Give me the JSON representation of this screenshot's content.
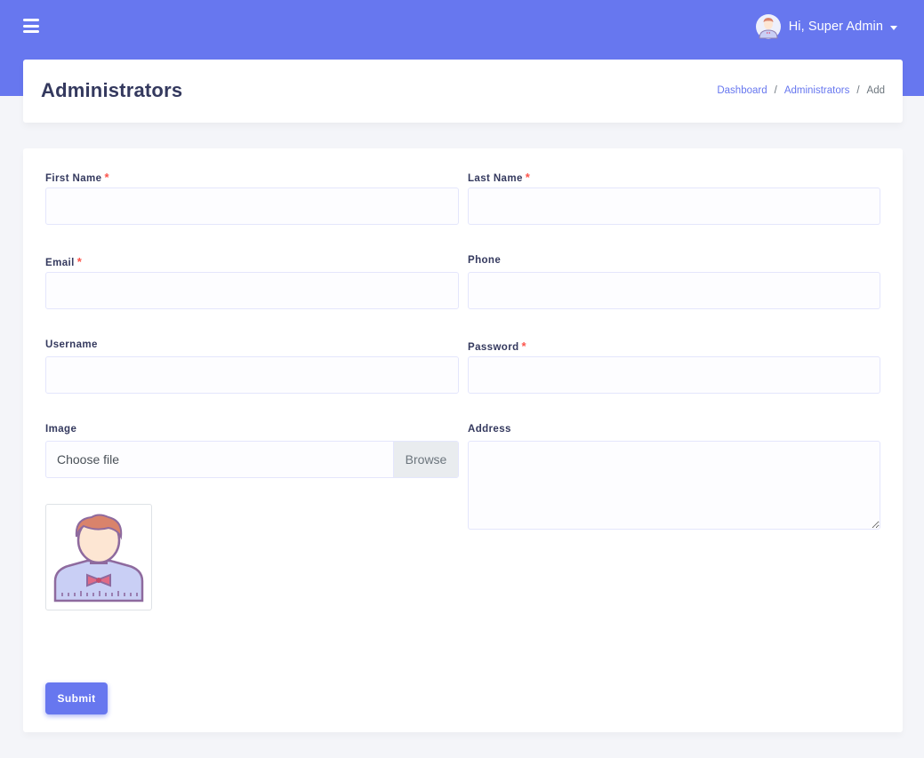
{
  "topbar": {
    "menu_icon": "hamburger-icon",
    "user_greeting": "Hi, Super Admin",
    "avatar_icon": "user-avatar-icon"
  },
  "header": {
    "title": "Administrators",
    "breadcrumb": [
      "Dashboard",
      "Administrators",
      "Add"
    ],
    "separator": "/"
  },
  "form": {
    "first_name": {
      "label": "First Name",
      "required": "*",
      "value": ""
    },
    "last_name": {
      "label": "Last Name",
      "required": "*",
      "value": ""
    },
    "email": {
      "label": "Email",
      "required": "*",
      "value": ""
    },
    "phone": {
      "label": "Phone",
      "value": ""
    },
    "username": {
      "label": "Username",
      "value": ""
    },
    "password": {
      "label": "Password",
      "required": "*",
      "value": ""
    },
    "image": {
      "label": "Image",
      "file_text": "Choose file",
      "browse_label": "Browse"
    },
    "address": {
      "label": "Address",
      "value": ""
    },
    "submit_label": "Submit"
  },
  "colors": {
    "accent": "#6777ef",
    "required": "#fc544b",
    "title": "#34395e"
  }
}
